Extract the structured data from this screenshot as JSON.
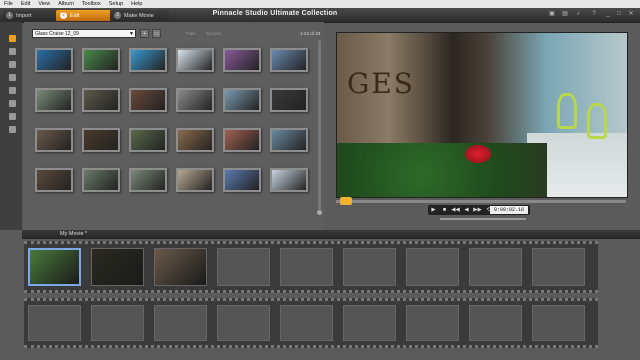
{
  "menu": [
    "File",
    "Edit",
    "View",
    "Album",
    "Toolbox",
    "Setup",
    "Help"
  ],
  "tabs": {
    "import": "Import",
    "edit": "Edit",
    "make": "Make Movie"
  },
  "app_title": "Pinnacle Studio Ultimate Collection",
  "title_icons": [
    "disk-icon",
    "film-icon",
    "speaker-icon",
    "help-icon",
    "question-icon",
    "minimize-icon",
    "restore-icon",
    "close-icon"
  ],
  "library": {
    "collection": "Glass Cruise 12_09",
    "filter_files": "Files",
    "filter_scenes": "Scenes",
    "count": "1-24 of 33",
    "thumb_colors": [
      [
        "#2a6ea8",
        "#4a8a4a",
        "#3a9ad0",
        "#d8e4ec",
        "#8a5a9a",
        "#6a8ab0"
      ],
      [
        "#7a8c7a",
        "#5a5a4a",
        "#6a4a3a",
        "#8a8a8a",
        "#7a9ab0",
        "#3a3a3a"
      ],
      [
        "#6a5a4a",
        "#4a3a2a",
        "#5a6a4a",
        "#8a6a4a",
        "#a06050",
        "#6a8aa0"
      ],
      [
        "#5a4a3a",
        "#6a7a6a",
        "#7a8a7a",
        "#b8a890",
        "#5a7ab0",
        "#c8d4e0"
      ]
    ]
  },
  "transport": {
    "buttons": [
      "▶",
      "■",
      "◀◀",
      "◀",
      "▶▶",
      "⟲"
    ],
    "timecode": "0:00:02.16"
  },
  "timeline": {
    "movie_name": "My Movie *",
    "track1_clip_colors": [
      "#4a7a3a",
      "#2a2a22",
      "#6a5a4a"
    ]
  }
}
